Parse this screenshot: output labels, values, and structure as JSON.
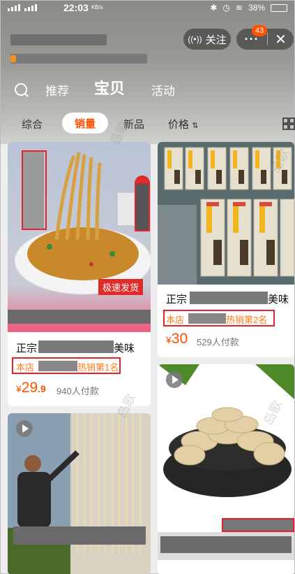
{
  "status_bar": {
    "time": "22:03",
    "speed_unit": "KB/s",
    "battery": "38%"
  },
  "header": {
    "follow_icon": "radio-waves-icon",
    "follow_label": "关注",
    "more_label": "···",
    "message_count": "43",
    "close_label": "✕"
  },
  "nav": {
    "tabs": [
      "推荐",
      "宝贝",
      "活动"
    ],
    "active_tab": "宝贝"
  },
  "filters": {
    "items": [
      "综合",
      "销量",
      "新品",
      "价格"
    ],
    "active": "销量"
  },
  "products": [
    {
      "title_start": "正宗",
      "title_end": "美味",
      "rank_start": "本店",
      "rank_end": "热销第1名",
      "currency": "¥",
      "price_int": "29",
      "price_dec": ".9",
      "sold": "940人付款",
      "tag": "极速发货"
    },
    {
      "title_start": "正宗",
      "title_end": "美味",
      "rank_start": "本店",
      "rank_end": "热销第2名",
      "currency": "¥",
      "price_int": "30",
      "price_dec": "",
      "sold": "529人付款"
    }
  ],
  "colors": {
    "accent": "#ff5000",
    "highlight_box": "#e8202a",
    "rank_text": "#ff7a1a"
  }
}
